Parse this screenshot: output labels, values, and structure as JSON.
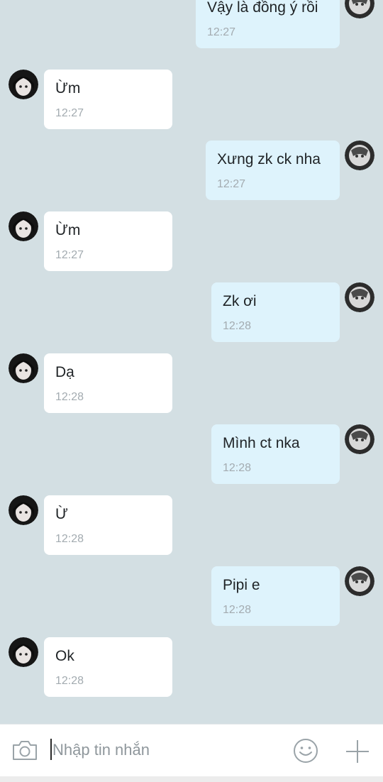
{
  "conversation": {
    "messages": [
      {
        "direction": "out",
        "text": "Vậy là đồng ý rồi",
        "time": "12:27"
      },
      {
        "direction": "in",
        "text": "Ừm",
        "time": "12:27"
      },
      {
        "direction": "out",
        "text": "Xưng zk ck nha",
        "time": "12:27"
      },
      {
        "direction": "in",
        "text": "Ừm",
        "time": "12:27"
      },
      {
        "direction": "out",
        "text": "Zk ơi",
        "time": "12:28"
      },
      {
        "direction": "in",
        "text": "Dạ",
        "time": "12:28"
      },
      {
        "direction": "out",
        "text": "Mình ct nka",
        "time": "12:28"
      },
      {
        "direction": "in",
        "text": "Ừ",
        "time": "12:28"
      },
      {
        "direction": "out",
        "text": "Pipi e",
        "time": "12:28"
      },
      {
        "direction": "in",
        "text": "Ok",
        "time": "12:28"
      }
    ]
  },
  "composer": {
    "placeholder": "Nhập tin nhắn",
    "value": "",
    "camera_icon": "camera-icon",
    "emoji_icon": "emoji-smiley-icon",
    "plus_icon": "plus-icon"
  },
  "colors": {
    "chat_background": "#d3dfe3",
    "incoming_bubble": "#ffffff",
    "outgoing_bubble": "#def3fc",
    "timestamp": "#a3abb0",
    "icon": "#9aa3a8"
  }
}
